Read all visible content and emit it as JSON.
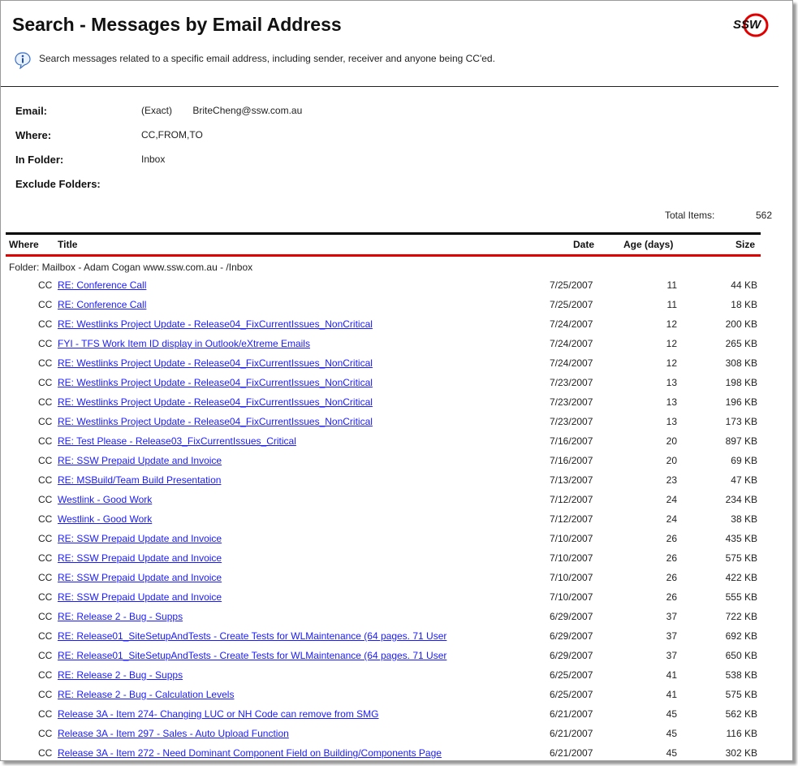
{
  "header": {
    "title": "Search - Messages by Email Address",
    "description": "Search messages related to a specific email address, including sender, receiver and anyone being CC'ed.",
    "logo_text": "SSW",
    "brand_color": "#e00000"
  },
  "criteria": {
    "email_label": "Email:",
    "email_mode": "(Exact)",
    "email_value": "BriteCheng@ssw.com.au",
    "where_label": "Where:",
    "where_value": "CC,FROM,TO",
    "folder_label": "In Folder:",
    "folder_value": "Inbox",
    "exclude_label": "Exclude Folders:",
    "exclude_value": ""
  },
  "summary": {
    "total_label": "Total Items:",
    "total_value": "562"
  },
  "table": {
    "columns": [
      "Where",
      "Title",
      "Date",
      "Age (days)",
      "Size"
    ],
    "folder_line": "Folder: Mailbox - Adam Cogan www.ssw.com.au - /Inbox",
    "rows": [
      {
        "where": "CC",
        "title": "RE: Conference Call",
        "date": "7/25/2007",
        "age": "11",
        "size": "44 KB"
      },
      {
        "where": "CC",
        "title": "RE: Conference Call",
        "date": "7/25/2007",
        "age": "11",
        "size": "18 KB"
      },
      {
        "where": "CC",
        "title": "RE: Westlinks Project Update - Release04_FixCurrentIssues_NonCritical",
        "date": "7/24/2007",
        "age": "12",
        "size": "200 KB"
      },
      {
        "where": "CC",
        "title": "FYI - TFS Work Item ID display in Outlook/eXtreme Emails",
        "date": "7/24/2007",
        "age": "12",
        "size": "265 KB"
      },
      {
        "where": "CC",
        "title": "RE: Westlinks Project Update - Release04_FixCurrentIssues_NonCritical",
        "date": "7/24/2007",
        "age": "12",
        "size": "308 KB"
      },
      {
        "where": "CC",
        "title": "RE: Westlinks Project Update - Release04_FixCurrentIssues_NonCritical",
        "date": "7/23/2007",
        "age": "13",
        "size": "198 KB"
      },
      {
        "where": "CC",
        "title": "RE: Westlinks Project Update - Release04_FixCurrentIssues_NonCritical",
        "date": "7/23/2007",
        "age": "13",
        "size": "196 KB"
      },
      {
        "where": "CC",
        "title": "RE: Westlinks Project Update - Release04_FixCurrentIssues_NonCritical",
        "date": "7/23/2007",
        "age": "13",
        "size": "173 KB"
      },
      {
        "where": "CC",
        "title": "RE: Test Please - Release03_FixCurrentIssues_Critical",
        "date": "7/16/2007",
        "age": "20",
        "size": "897 KB"
      },
      {
        "where": "CC",
        "title": "RE: SSW Prepaid Update and Invoice",
        "date": "7/16/2007",
        "age": "20",
        "size": "69 KB"
      },
      {
        "where": "CC",
        "title": "RE: MSBuild/Team Build Presentation",
        "date": "7/13/2007",
        "age": "23",
        "size": "47 KB"
      },
      {
        "where": "CC",
        "title": "Westlink - Good Work",
        "date": "7/12/2007",
        "age": "24",
        "size": "234 KB"
      },
      {
        "where": "CC",
        "title": "Westlink - Good Work",
        "date": "7/12/2007",
        "age": "24",
        "size": "38 KB"
      },
      {
        "where": "CC",
        "title": "RE: SSW Prepaid Update and Invoice",
        "date": "7/10/2007",
        "age": "26",
        "size": "435 KB"
      },
      {
        "where": "CC",
        "title": "RE: SSW Prepaid Update and Invoice",
        "date": "7/10/2007",
        "age": "26",
        "size": "575 KB"
      },
      {
        "where": "CC",
        "title": "RE: SSW Prepaid Update and Invoice",
        "date": "7/10/2007",
        "age": "26",
        "size": "422 KB"
      },
      {
        "where": "CC",
        "title": "RE: SSW Prepaid Update and Invoice",
        "date": "7/10/2007",
        "age": "26",
        "size": "555 KB"
      },
      {
        "where": "CC",
        "title": "RE: Release 2 - Bug - Supps",
        "date": "6/29/2007",
        "age": "37",
        "size": "722 KB"
      },
      {
        "where": "CC",
        "title": "RE: Release01_SiteSetupAndTests - Create Tests for WLMaintenance (64 pages. 71 User",
        "date": "6/29/2007",
        "age": "37",
        "size": "692 KB"
      },
      {
        "where": "CC",
        "title": "RE: Release01_SiteSetupAndTests - Create Tests for WLMaintenance (64 pages. 71 User",
        "date": "6/29/2007",
        "age": "37",
        "size": "650 KB"
      },
      {
        "where": "CC",
        "title": "RE: Release 2 - Bug - Supps",
        "date": "6/25/2007",
        "age": "41",
        "size": "538 KB"
      },
      {
        "where": "CC",
        "title": "RE: Release 2 - Bug - Calculation Levels",
        "date": "6/25/2007",
        "age": "41",
        "size": "575 KB"
      },
      {
        "where": "CC",
        "title": "Release 3A - Item 274- Changing LUC or NH Code can remove from SMG",
        "date": "6/21/2007",
        "age": "45",
        "size": "562 KB"
      },
      {
        "where": "CC",
        "title": "Release 3A - Item 297 - Sales - Auto Upload Function",
        "date": "6/21/2007",
        "age": "45",
        "size": "116 KB"
      },
      {
        "where": "CC",
        "title": "Release 3A - Item 272 - Need Dominant Component Field on Building/Components Page",
        "date": "6/21/2007",
        "age": "45",
        "size": "302 KB"
      }
    ]
  }
}
